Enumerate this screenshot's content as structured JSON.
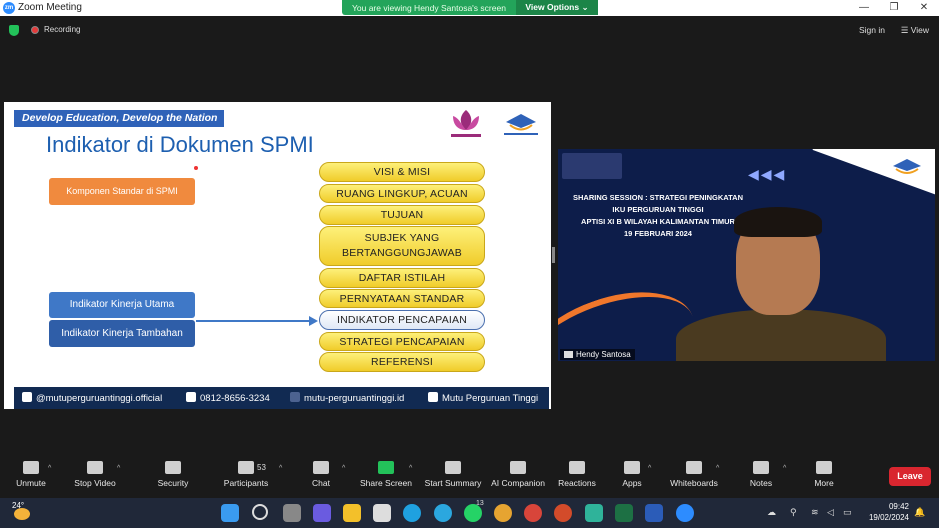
{
  "window": {
    "title": "Zoom Meeting",
    "logo": "zm"
  },
  "share_banner": {
    "text": "You are viewing Hendy Santosa's screen",
    "view_options": "View Options"
  },
  "topbar": {
    "recording": "Recording",
    "sign_in": "Sign in",
    "view": "View"
  },
  "slide": {
    "tagline": "Develop Education, Develop the Nation",
    "title": "Indikator di Dokumen SPMI",
    "komponen": "Komponen Standar di SPMI",
    "iku": "Indikator Kinerja Utama",
    "ikt": "Indikator Kinerja Tambahan",
    "pills": [
      "VISI & MISI",
      "RUANG LINGKUP, ACUAN",
      "TUJUAN",
      "SUBJEK YANG BERTANGGUNGJAWAB",
      "DAFTAR ISTILAH",
      "PERNYATAAN STANDAR",
      "INDIKATOR PENCAPAIAN",
      "STRATEGI PENCAPAIAN",
      "REFERENSI"
    ],
    "footer": {
      "instagram": "@mutuperguruantinggi.official",
      "phone": "0812-8656-3234",
      "web": "mutu-perguruantinggi.id",
      "youtube": "Mutu Perguruan Tinggi"
    }
  },
  "video": {
    "line1": "SHARING SESSION : STRATEGI PENINGKATAN",
    "line2": "IKU PERGURUAN TINGGI",
    "line3": "APTISI XI B WILAYAH KALIMANTAN TIMUR",
    "line4": "19 FEBRUARI 2024",
    "participant": "Hendy Santosa"
  },
  "toolbar": {
    "unmute": "Unmute",
    "stop_video": "Stop Video",
    "security": "Security",
    "participants": "Participants",
    "participants_count": "53",
    "chat": "Chat",
    "share_screen": "Share Screen",
    "start_summary": "Start Summary",
    "ai_companion": "AI Companion",
    "reactions": "Reactions",
    "apps": "Apps",
    "whiteboards": "Whiteboards",
    "notes": "Notes",
    "more": "More",
    "leave": "Leave"
  },
  "taskbar": {
    "temperature": "24°",
    "time": "09:42",
    "date": "19/02/2024",
    "whatsapp_badge": "13"
  },
  "colors": {
    "accent": "#2d8cff",
    "leave": "#d9262f",
    "share_green": "#23c25a",
    "banner_green": "#23a45a"
  }
}
